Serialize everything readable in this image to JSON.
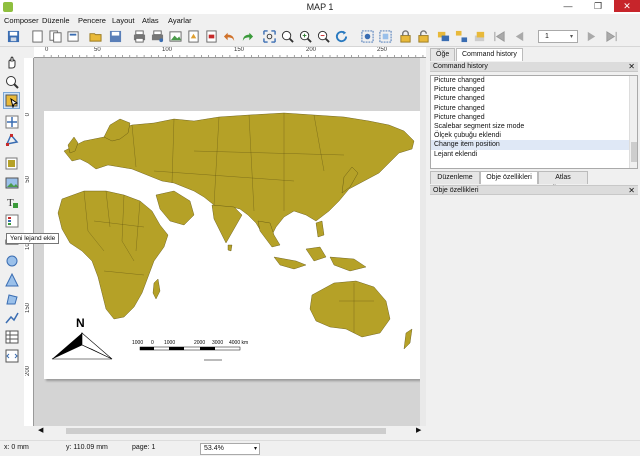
{
  "window": {
    "title": "MAP 1"
  },
  "menu": [
    "Composer",
    "Düzenle",
    "Pencere",
    "Layout",
    "Atlas",
    "Ayarlar"
  ],
  "toolbar": {
    "page_value": "1",
    "icons": [
      "save-icon",
      "new-icon",
      "duplicate-icon",
      "manager-icon",
      "open-icon",
      "save-template-icon",
      "print-icon",
      "print-setup-icon",
      "export-image-icon",
      "export-svg-icon",
      "export-pdf-icon",
      "undo-icon",
      "redo-icon",
      "zoom-full-icon",
      "zoom-100-icon",
      "zoom-in-icon",
      "zoom-out-icon",
      "refresh-icon",
      "select-all-icon",
      "select-icon",
      "lock-icon",
      "unlock-icon",
      "group-icon",
      "ungroup-icon",
      "raise-icon",
      "first-feature-icon",
      "prev-feature-icon",
      "next-feature-icon",
      "last-feature-icon"
    ]
  },
  "left_tools": {
    "tooltip": "Yeni lejand ekle",
    "icons": [
      "pan-icon",
      "zoom-icon",
      "select-move-icon",
      "move-content-icon",
      "edit-nodes-icon",
      "add-map-icon",
      "add-image-icon",
      "add-label-icon",
      "add-legend-icon",
      "add-scalebar-icon",
      "add-shape-icon",
      "add-triangle-icon",
      "add-polygon-icon",
      "add-polyline-icon",
      "add-attribute-table-icon",
      "add-html-icon"
    ]
  },
  "rulers": {
    "horizontal": [
      "0",
      "50",
      "100",
      "150",
      "200",
      "250"
    ],
    "vertical": [
      "0",
      "50",
      "100",
      "150",
      "200"
    ]
  },
  "map": {
    "scalebar_labels": [
      "1000",
      "0",
      "1000",
      "2000",
      "3000",
      "4000 km"
    ],
    "north_label": "N"
  },
  "status": {
    "x": "x: 0 mm",
    "y": "y: 110.09 mm",
    "page": "page: 1",
    "zoom": "53.4%"
  },
  "right_panel": {
    "top_tabs": [
      "Öğe",
      "Command history"
    ],
    "active_top_tab": 1,
    "history_title": "Command history",
    "history_items": [
      "Picture changed",
      "Picture changed",
      "Picture changed",
      "Picture changed",
      "Picture changed",
      "Scalebar segment size mode",
      "Ölçek çubuğu eklendi",
      "Change item position",
      "Lejant eklendi"
    ],
    "selected_history_index": 7,
    "bottom_tabs": [
      "Düzenleme",
      "Obje özellikleri",
      "Atlas Üretimi"
    ],
    "active_bottom_tab": 1,
    "properties_title": "Obje özellikleri"
  },
  "colors": {
    "land": "#b5a127",
    "ocean": "#ffffff",
    "canvas_bg": "#d4d4d4",
    "selection": "#dfe8f6"
  }
}
